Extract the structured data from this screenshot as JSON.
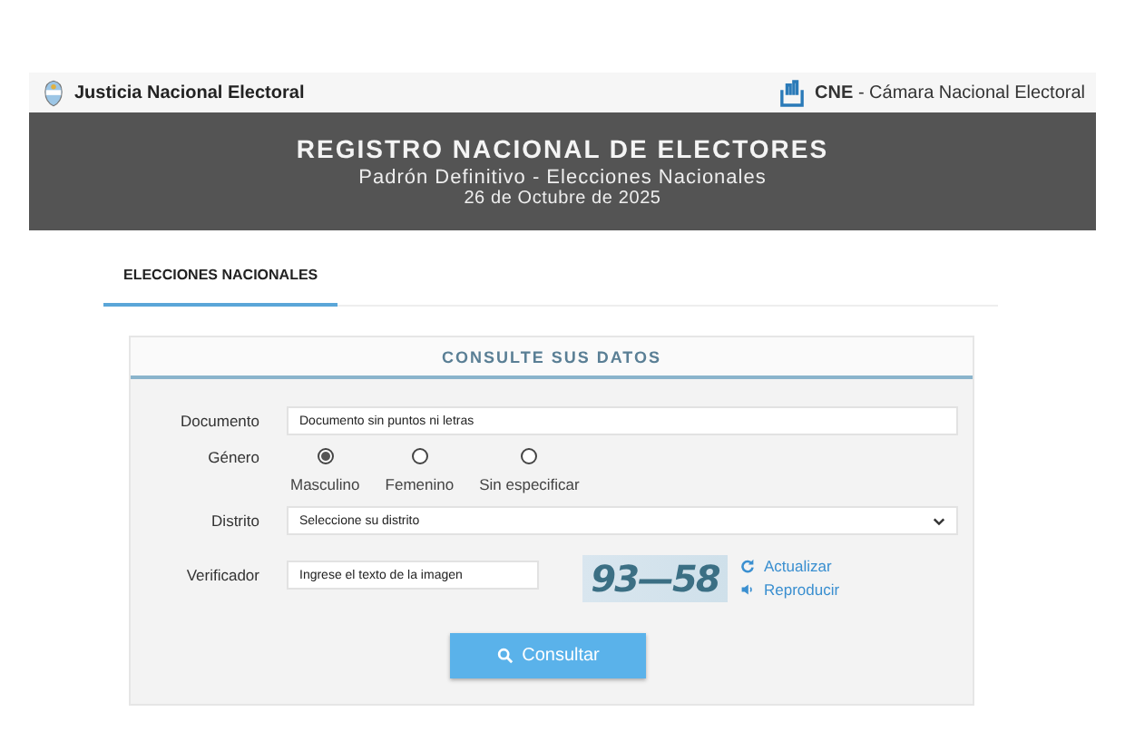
{
  "topbar": {
    "left": "Justicia Nacional Electoral",
    "right_bold": "CNE",
    "right": " - Cámara Nacional Electoral"
  },
  "banner": {
    "title": "REGISTRO NACIONAL DE ELECTORES",
    "subtitle": "Padrón Definitivo - Elecciones Nacionales",
    "date": "26 de Octubre de 2025"
  },
  "tabs": [
    {
      "label": "ELECCIONES NACIONALES",
      "selected": true
    }
  ],
  "form": {
    "title": "CONSULTE SUS DATOS",
    "documento": {
      "label": "Documento",
      "placeholder": "Documento sin puntos ni letras"
    },
    "genero": {
      "label": "Género",
      "options": [
        {
          "label": "Masculino",
          "selected": true
        },
        {
          "label": "Femenino",
          "selected": false
        },
        {
          "label": "Sin especificar",
          "selected": false
        }
      ]
    },
    "distrito": {
      "label": "Distrito",
      "value": "Seleccione su distrito"
    },
    "verificador": {
      "label": "Verificador",
      "placeholder": "Ingrese el texto de la imagen",
      "captcha": "93—58",
      "refresh": "Actualizar",
      "audio": "Reproducir"
    },
    "submit": "Consultar"
  }
}
